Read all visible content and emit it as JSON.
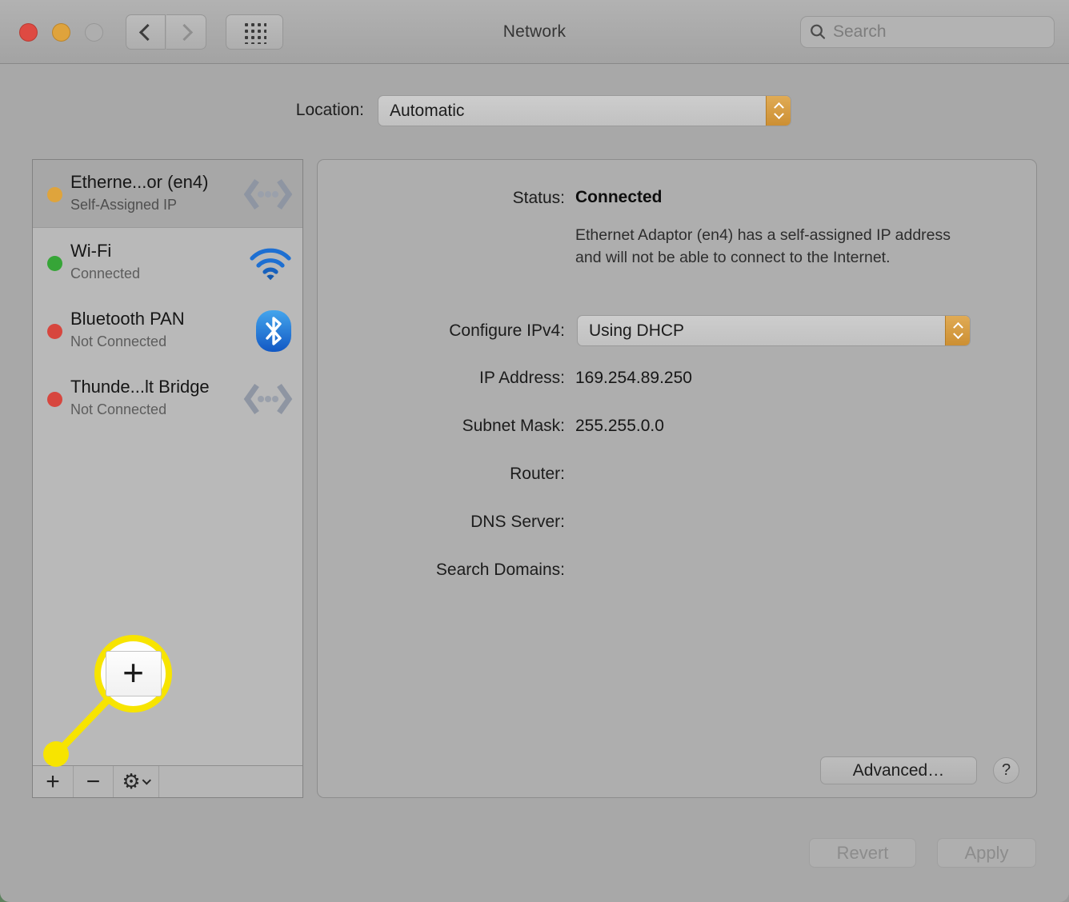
{
  "window": {
    "title": "Network",
    "background_color": "#a8a8a8"
  },
  "titlebar": {
    "search_placeholder": "Search"
  },
  "location": {
    "label": "Location:",
    "value": "Automatic"
  },
  "colors": {
    "accent_orange": "#d2953e",
    "callout_yellow": "#f7e400",
    "wifi_blue": "#1d6fd2",
    "bluetooth_blue": "#2a8ade"
  },
  "sidebar": {
    "items": [
      {
        "title": "Etherne...or (en4)",
        "subtitle": "Self-Assigned IP",
        "status_color": "#dfa43c",
        "icon": "ethernet-icon",
        "selected": true
      },
      {
        "title": "Wi-Fi",
        "subtitle": "Connected",
        "status_color": "#36a537",
        "icon": "wifi-icon",
        "selected": false
      },
      {
        "title": "Bluetooth PAN",
        "subtitle": "Not Connected",
        "status_color": "#d7463e",
        "icon": "bluetooth-icon",
        "selected": false
      },
      {
        "title": "Thunde...lt Bridge",
        "subtitle": "Not Connected",
        "status_color": "#d7463e",
        "icon": "ethernet-icon",
        "selected": false
      }
    ],
    "toolbar": {
      "add_label": "+",
      "remove_label": "−"
    }
  },
  "details": {
    "status": {
      "label": "Status:",
      "value": "Connected",
      "description": "Ethernet Adaptor (en4) has a self-assigned IP address and will not be able to connect to the Internet."
    },
    "configure_ipv4": {
      "label": "Configure IPv4:",
      "value": "Using DHCP"
    },
    "ip_address": {
      "label": "IP Address:",
      "value": "169.254.89.250"
    },
    "subnet_mask": {
      "label": "Subnet Mask:",
      "value": "255.255.0.0"
    },
    "router": {
      "label": "Router:",
      "value": ""
    },
    "dns_server": {
      "label": "DNS Server:",
      "value": ""
    },
    "search_domains": {
      "label": "Search Domains:",
      "value": ""
    },
    "advanced_label": "Advanced…",
    "help_label": "?"
  },
  "footer": {
    "revert_label": "Revert",
    "apply_label": "Apply"
  },
  "callout": {
    "plus_label": "+"
  }
}
